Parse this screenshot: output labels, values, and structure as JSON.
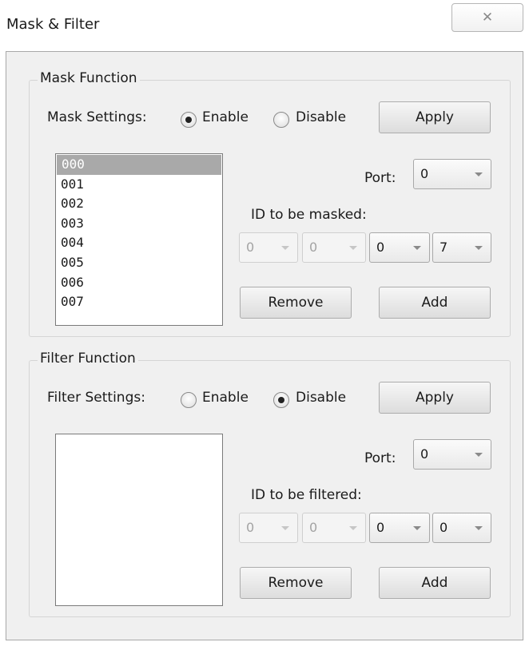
{
  "window": {
    "title": "Mask & Filter",
    "close_glyph": "✕"
  },
  "mask": {
    "group_title": "Mask Function",
    "settings_label": "Mask Settings:",
    "enable_label": "Enable",
    "disable_label": "Disable",
    "selected_setting": "Enable",
    "apply_label": "Apply",
    "list_items": [
      "000",
      "001",
      "002",
      "003",
      "004",
      "005",
      "006",
      "007"
    ],
    "selected_item": "000",
    "port_label": "Port:",
    "port_value": "0",
    "id_label": "ID to be masked:",
    "id_digits": [
      "0",
      "0",
      "0",
      "7"
    ],
    "remove_label": "Remove",
    "add_label": "Add"
  },
  "filter": {
    "group_title": "Filter Function",
    "settings_label": "Filter Settings:",
    "enable_label": "Enable",
    "disable_label": "Disable",
    "selected_setting": "Disable",
    "apply_label": "Apply",
    "list_items": [],
    "port_label": "Port:",
    "port_value": "0",
    "id_label": "ID to be filtered:",
    "id_digits": [
      "0",
      "0",
      "0",
      "0"
    ],
    "remove_label": "Remove",
    "add_label": "Add"
  }
}
